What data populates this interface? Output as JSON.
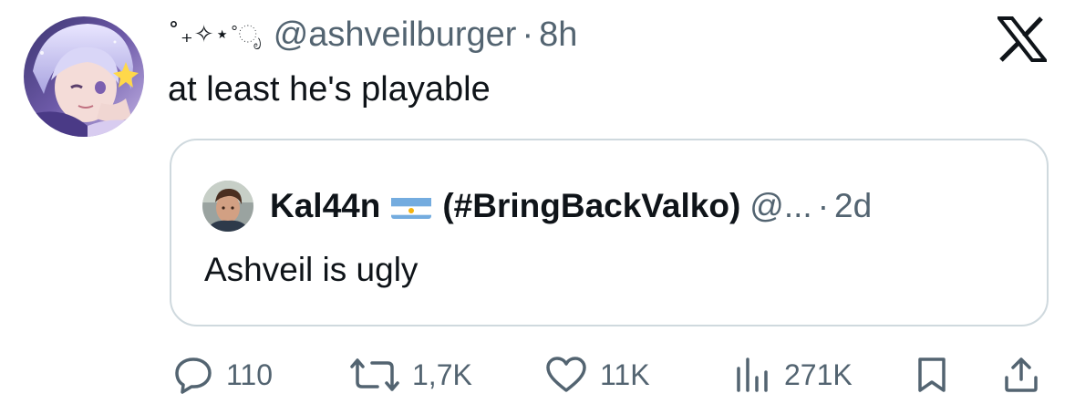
{
  "tweet": {
    "display_name": "˚₊✧⋆˚ೃ",
    "handle": "@ashveilburger",
    "separator": "·",
    "timestamp": "8h",
    "text": "at least he's playable",
    "avatar_icon": "anime-character-avatar"
  },
  "quote": {
    "name": "Kal44n",
    "flag_icon": "argentina-flag",
    "name_suffix": "(#BringBackValko)",
    "handle": "@...",
    "separator": "·",
    "timestamp": "2d",
    "text": "Ashveil is ugly"
  },
  "actions": {
    "replies": "110",
    "reposts": "1,7K",
    "likes": "11K",
    "views": "271K"
  },
  "icons": {
    "brand": "x-logo-icon",
    "reply": "reply-icon",
    "repost": "repost-icon",
    "like": "heart-icon",
    "views": "views-icon",
    "bookmark": "bookmark-icon",
    "share": "share-icon"
  },
  "colors": {
    "text_primary": "#0f1419",
    "text_secondary": "#536471",
    "border": "#cfd9de"
  }
}
